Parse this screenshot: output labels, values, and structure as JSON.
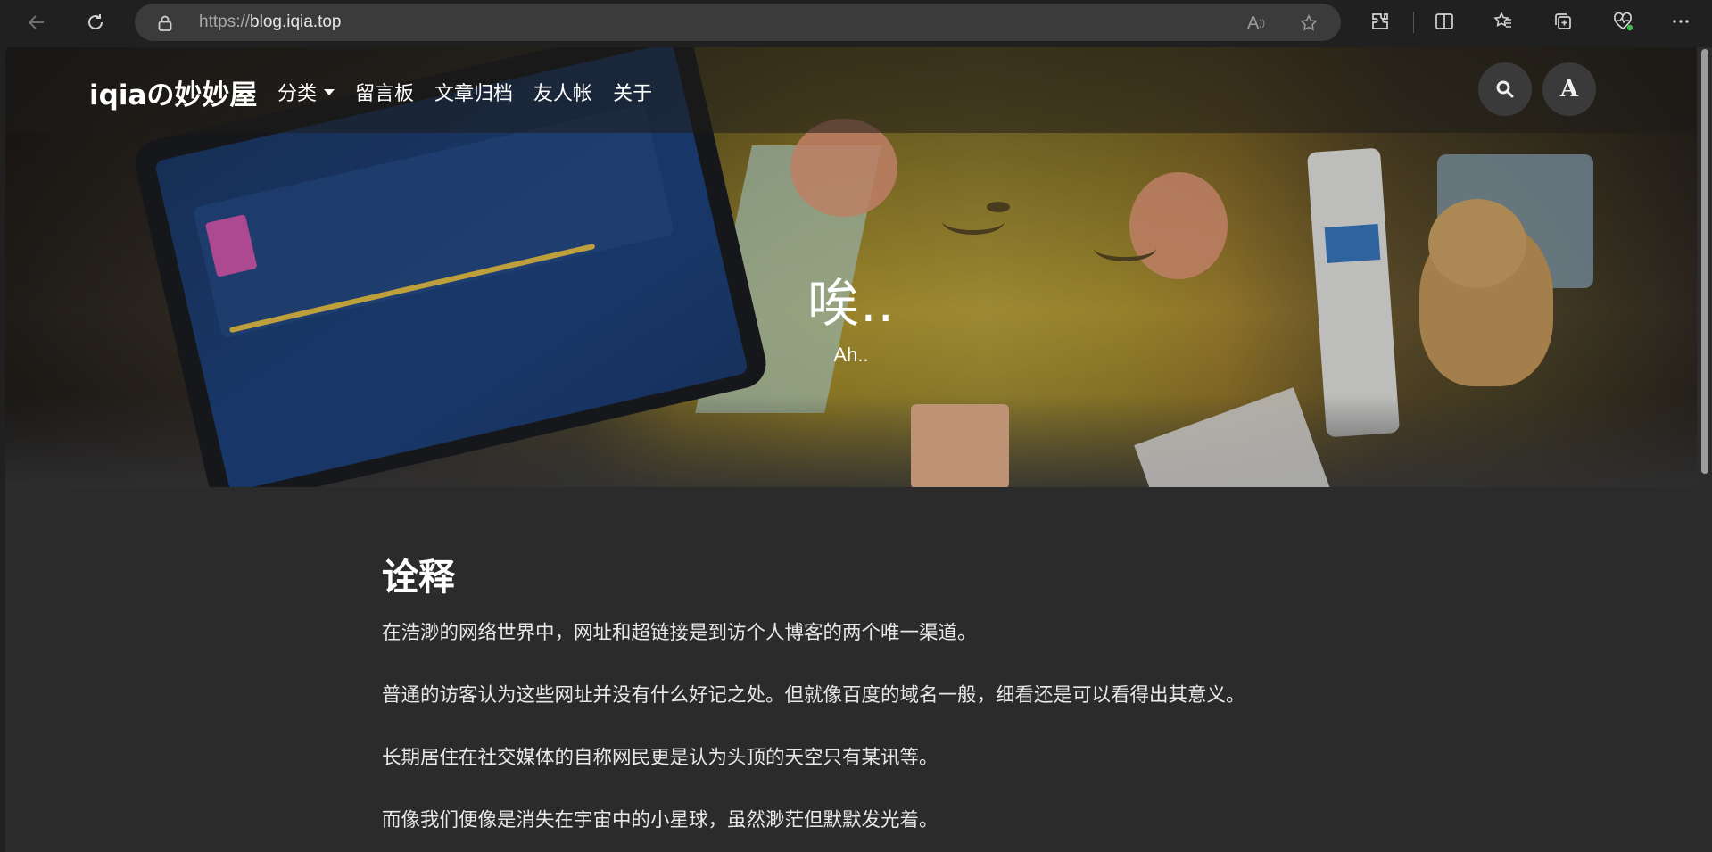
{
  "browser": {
    "url_protocol": "https://",
    "url_host": "blog.iqia.top",
    "icons": [
      "back-icon",
      "refresh-icon",
      "lock-icon",
      "read-aloud-icon",
      "favorite-star-icon",
      "extensions-icon",
      "split-screen-icon",
      "favorites-icon",
      "collections-icon",
      "browser-essentials-icon",
      "more-icon"
    ]
  },
  "site": {
    "brand": "iqiaの妙妙屋",
    "nav": {
      "category": "分类",
      "guestbook": "留言板",
      "archive": "文章归档",
      "friends": "友人帐",
      "about": "关于"
    }
  },
  "hero": {
    "title": "唉..",
    "subtitle": "Ah.."
  },
  "post": {
    "heading": "诠释",
    "paragraphs": [
      "在浩渺的网络世界中，网址和超链接是到访个人博客的两个唯一渠道。",
      "普通的访客认为这些网址并没有什么好记之处。但就像百度的域名一般，细看还是可以看得出其意义。",
      "长期居住在社交媒体的自称网民更是认为头顶的天空只有某讯等。",
      "而像我们便像是消失在宇宙中的小星球，虽然渺茫但默默发光着。"
    ]
  }
}
